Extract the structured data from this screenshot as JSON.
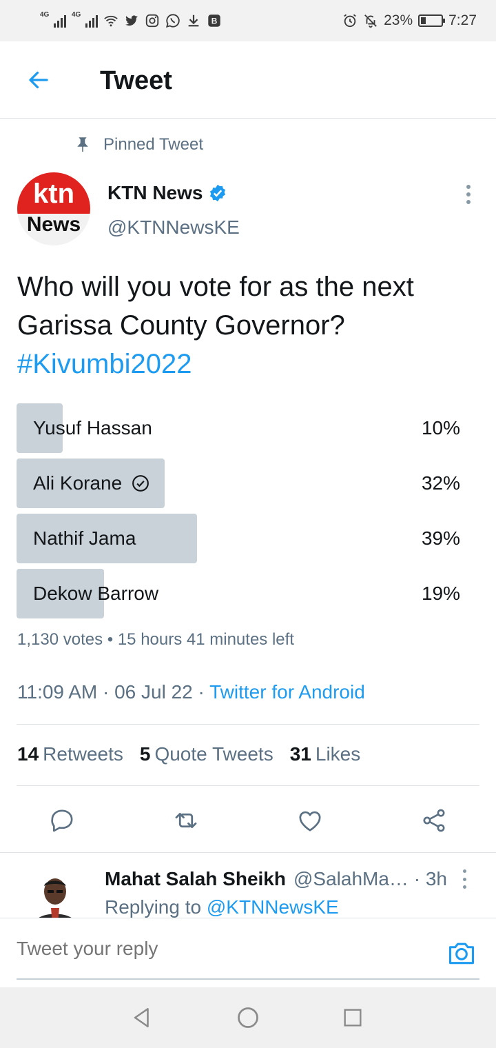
{
  "status_bar": {
    "network_1": "4G",
    "network_2": "4G",
    "battery_pct": "23%",
    "time": "7:27",
    "icons": [
      "signal-icon",
      "wifi-icon",
      "twitter-icon",
      "instagram-icon",
      "whatsapp-icon",
      "download-icon",
      "app-icon",
      "alarm-icon",
      "mute-icon",
      "battery-icon"
    ]
  },
  "header": {
    "title": "Tweet",
    "back_icon": "back-arrow-icon"
  },
  "tweet": {
    "pinned_label": "Pinned Tweet",
    "author": {
      "name": "KTN News",
      "handle": "@KTNNewsKE",
      "verified": true,
      "avatar_top": "ktn",
      "avatar_bottom": "News"
    },
    "text_line": "Who will you vote for as the next Garissa County Governor?",
    "hashtag": "#Kivumbi2022",
    "poll": {
      "options": [
        {
          "label": "Yusuf Hassan",
          "pct": "10%",
          "value": 10,
          "selected": false
        },
        {
          "label": "Ali Korane",
          "pct": "32%",
          "value": 32,
          "selected": true
        },
        {
          "label": "Nathif Jama",
          "pct": "39%",
          "value": 39,
          "selected": false
        },
        {
          "label": "Dekow Barrow",
          "pct": "19%",
          "value": 19,
          "selected": false
        }
      ],
      "meta": "1,130 votes • 15 hours 41 minutes left"
    },
    "time": "11:09 AM · 06 Jul 22 · ",
    "source": "Twitter for Android",
    "stats": {
      "retweets_count": "14",
      "retweets_label": "Retweets",
      "quotes_count": "5",
      "quotes_label": "Quote Tweets",
      "likes_count": "31",
      "likes_label": "Likes"
    }
  },
  "reply": {
    "name": "Mahat Salah Sheikh",
    "handle_time": "@SalahMa… · 3h",
    "replying_prefix": "Replying to ",
    "replying_to": "@KTNNewsKE"
  },
  "compose": {
    "placeholder": "Tweet your reply"
  },
  "colors": {
    "accent": "#1d9bf0",
    "poll_bar": "#c9d2d9",
    "muted": "#5b7083"
  }
}
